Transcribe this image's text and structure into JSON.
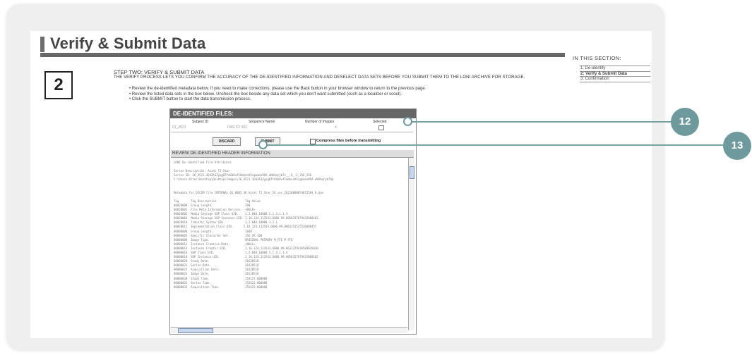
{
  "page": {
    "title": "Verify & Submit Data",
    "step_number": "2",
    "step_heading": "STEP TWO: VERIFY & SUBMIT DATA",
    "step_description": "THE VERIFY PROCESS LETS YOU CONFIRM THE ACCURACY OF THE DE-IDENTIFIED INFORMATION AND DESELECT DATA SETS BEFORE YOU SUBMIT THEM TO THE LONI ARCHIVE FOR STORAGE.",
    "bullets": [
      "Review the de-identified metadata below. If you need to make corrections, please use the Back button in your browser window to return to the previous page.",
      "Review the listed data sets in the box below. Uncheck the box beside any data set which you don't want submitted (such as a localizer or scout).",
      "Click the SUBMIT button to start the data transmission process."
    ]
  },
  "sidebar": {
    "heading": "IN THIS SECTION:",
    "links": [
      "1: De-identify",
      "2: Verify & Submit Data",
      "3: Confirmation"
    ]
  },
  "panel": {
    "heading": "DE-IDENTIFIED FILES:",
    "columns": [
      "Subject ID",
      "Sequence Name",
      "Number of Images",
      "Selected"
    ],
    "row": [
      "01_4521",
      "DAS C2 001",
      "4",
      ""
    ],
    "discard_label": "DISCARD",
    "submit_label": "SUBMIT",
    "compress_label": "Compress files before transmitting",
    "review_label": "REVIEW DE-IDENTIFIED HEADER INFORMATION",
    "log_lines": [
      "LONI De-identified File Attributes",
      "",
      "Series Description: Axial T2-Star",
      "Series ID: 26_4521.1D4ZA3ZypgDTYdSb8ufIAmhonXSigmaeoVDA.aNXAqryb7c__-6_-2_256_256",
      "C:\\Users\\Xitec\\Desktop\\Desktop\\Images\\26_4521.1D4ZA3ZypgDTYdSb8ufIAmhonXSigmaeoVDA.aNXAqryb7Qq",
      "",
      "",
      "Metadata for DICOM file INTERNAL_01_0005_SE_Axial_T2 Star_56_sec_20210000054072584_8.dcm",
      "",
      "Tag       Tag Description                 Tag Value",
      "00020000  Group Length.                   198",
      "00020001  File Meta Information Version.  <BULK>",
      "00020002  Media Storage SOP Class UID.    1.2.840.10008.5.1.4.1.1.4",
      "00020003  Media Storage SOP Instance UID. 2.16.124.113543.6006.99.0056357679432808102",
      "00020010  Transfer Syntax UID.            1.2.840.10008.1.2.1",
      "00020012  Implementation Class UID.      2.16.124.113543.6006.99.0001352525536088457",
      "00080000  Group Length.                   1048",
      "00080005  Specific Character Set.         ISO_IR 100",
      "00080008  Image Type.                     ORIGINAL PRIMARY M_FFE M FFE",
      "00080012  Instance Creation Date.         <NULL>",
      "00080014  Instance Creator UID.           2.16.124.113543.6006.99.0632379436589039430",
      "00080016  SOP Class UID.                  1.2.840.10008.5.1.4.1.1.4",
      "00080018  SOP Instance UID.               2.16.124.113543.6006.99.0056357679432808102",
      "00080020  Study Date.                     20120518",
      "00080021  Series Date.                    20120518",
      "00080022  Acquisition Date.               20120518",
      "00080023  Image Date.                     20120518",
      "00080030  Study Time.                     154127.000000",
      "00080031  Series Time.                    155422.000000",
      "00080032  Acquisition Time.               155422.000000"
    ]
  },
  "callouts": [
    "12",
    "13"
  ],
  "colors": {
    "accent": "#6e9a9e",
    "header_bar": "#666666"
  }
}
